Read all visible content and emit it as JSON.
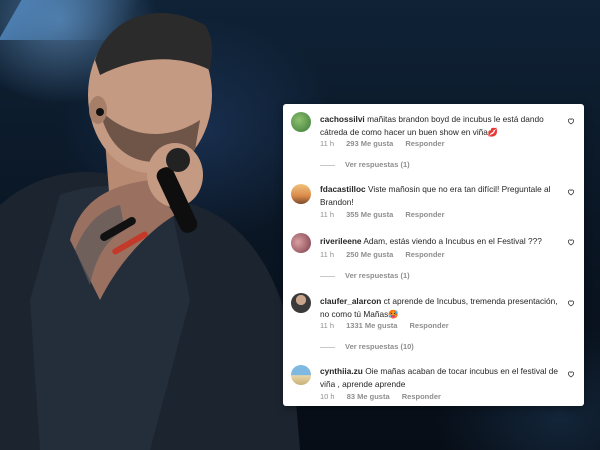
{
  "comments": [
    {
      "username": "cachossilvi",
      "text": "mañitas brandon boyd de incubus le está dando cátreda de como hacer un buen show en viña💋",
      "time": "11 h",
      "likes": "293 Me gusta",
      "reply": "Responder",
      "view_replies": "Ver respuestas (1)",
      "avatar_icon": "avatar-green-photo"
    },
    {
      "username": "fdacastilloc",
      "text": "Viste mañosin que no era tan difícil! Preguntale al Brandon!",
      "time": "11 h",
      "likes": "355 Me gusta",
      "reply": "Responder",
      "view_replies": "",
      "avatar_icon": "avatar-sunset-photo"
    },
    {
      "username": "riverileene",
      "text": "Adam, estás viendo a Incubus en el Festival ???",
      "time": "11 h",
      "likes": "250 Me gusta",
      "reply": "Responder",
      "view_replies": "Ver respuestas (1)",
      "avatar_icon": "avatar-people-photo"
    },
    {
      "username": "claufer_alarcon",
      "text": "ct aprende de Incubus, tremenda presentación, no como tú Mañas🥵",
      "time": "11 h",
      "likes": "1331 Me gusta",
      "reply": "Responder",
      "view_replies": "Ver respuestas (10)",
      "avatar_icon": "avatar-person-photo"
    },
    {
      "username": "cynthiia.zu",
      "text": "Oie mañas acaban de tocar incubus en el festival de viña , aprende aprende",
      "time": "10 h",
      "likes": "83 Me gusta",
      "reply": "Responder",
      "view_replies": "",
      "avatar_icon": "avatar-beach-photo"
    }
  ],
  "colors": {
    "text": "#262626",
    "meta": "#8e8e8e",
    "panel": "#ffffff"
  },
  "icons": {
    "like": "heart-outline-icon"
  }
}
